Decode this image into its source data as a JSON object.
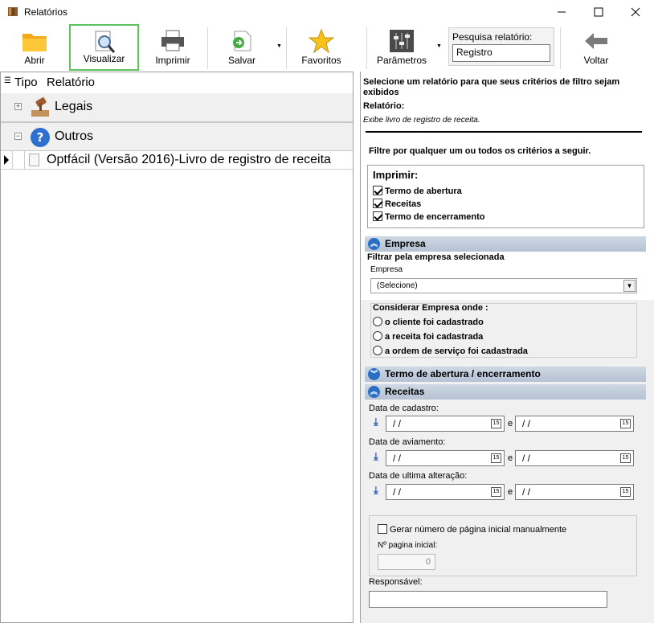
{
  "window": {
    "title": "Relatórios"
  },
  "toolbar": {
    "open": "Abrir",
    "view": "Visualizar",
    "print": "Imprimir",
    "save": "Salvar",
    "favorites": "Favoritos",
    "params": "Parâmetros",
    "search_label": "Pesquisa relatório:",
    "search_value": "Registro",
    "back": "Voltar"
  },
  "tree": {
    "col_tipo": "Tipo",
    "col_relatorio": "Relatório",
    "groups": [
      "Legais",
      "Outros"
    ],
    "row": "Optfácil (Versão 2016)-Livro de registro de receita"
  },
  "details": {
    "intro": "Selecione um relatório para que seus critérios de filtro sejam exibidos",
    "report_label": "Relatório:",
    "report_desc": "Exibe livro de registro de receita.",
    "filter_hint": "Filtre por qualquer um ou todos os critérios a seguir.",
    "print_title": "Imprimir:",
    "print_items": [
      "Termo de abertura",
      "Receitas",
      "Termo de encerramento"
    ],
    "empresa": {
      "header": "Empresa",
      "filter_title": "Filtrar pela empresa selecionada",
      "field_label": "Empresa",
      "select_value": "(Selecione)",
      "consider_title": "Considerar Empresa onde :",
      "options": [
        "o cliente  foi cadastrado",
        "a receita foi cadastrada",
        "a ordem de serviço foi cadastrada"
      ]
    },
    "termo_header": "Termo de abertura / encerramento",
    "receitas": {
      "header": "Receitas",
      "date_labels": [
        "Data de cadastro:",
        "Data de aviamento:",
        "Data de ultima alteração:"
      ],
      "date_value": "/ /",
      "and": "e",
      "cal_icon_text": "15",
      "gen_page": "Gerar número de página inicial manualmente",
      "page_label": "Nº pagina inicial:",
      "page_value": "0",
      "responsavel": "Responsável:"
    }
  }
}
